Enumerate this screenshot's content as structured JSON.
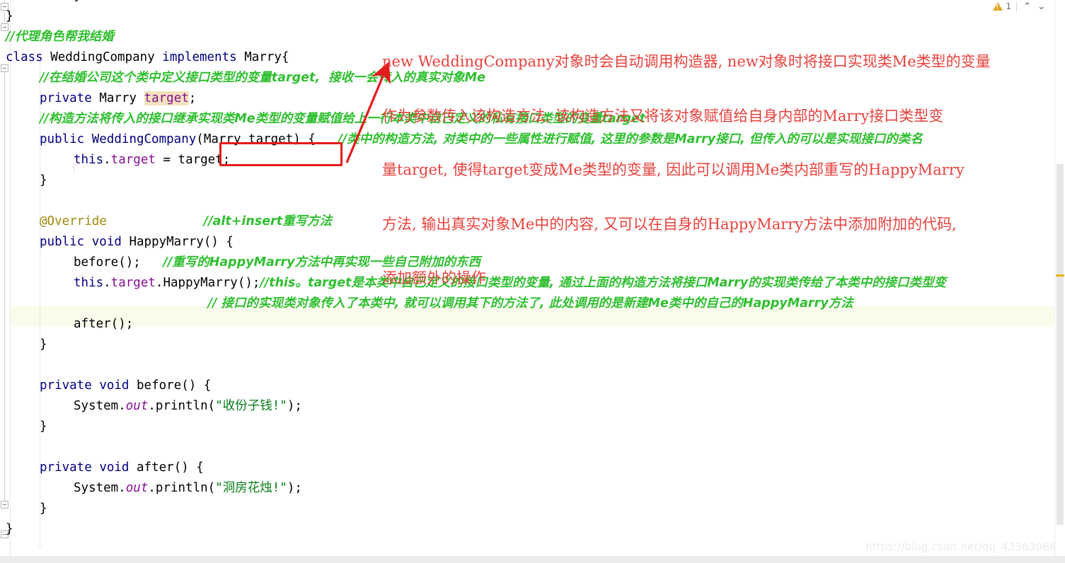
{
  "editor": {
    "language": "java",
    "font_px": 17.5,
    "line_height_px": 29,
    "theme": "IntelliJ Light"
  },
  "colors": {
    "keyword": "#000080",
    "comment_green": "#2fbf2f",
    "string": "#067d17",
    "field_purple": "#871094",
    "annotation_gold": "#9e880d",
    "red_annotation": "#e8413c",
    "red_box": "#e21b1b",
    "highlight_band": "#fbfbec",
    "token_highlight": "#f3e2bd",
    "warning_marker": "#e3b400"
  },
  "code_lines": [
    {
      "indent": 2,
      "tokens": [
        {
          "t": "}",
          "c": "plain"
        }
      ]
    },
    {
      "indent": 0,
      "tokens": [
        {
          "t": "}",
          "c": "plain"
        }
      ]
    },
    {
      "indent": 0,
      "tokens": [
        {
          "t": "//代理角色帮我结婚",
          "c": "cmt-cn"
        }
      ]
    },
    {
      "indent": 0,
      "tokens": [
        {
          "t": "class",
          "c": "kw"
        },
        {
          "t": " ",
          "c": "plain"
        },
        {
          "t": "WeddingCompany",
          "c": "ident"
        },
        {
          "t": " ",
          "c": "plain"
        },
        {
          "t": "implements",
          "c": "kw"
        },
        {
          "t": " ",
          "c": "plain"
        },
        {
          "t": "Marry{",
          "c": "ident"
        }
      ]
    },
    {
      "indent": 1,
      "tokens": [
        {
          "t": "//在结婚公司这个类中定义接口类型的变量target,  接收一会传入的真实对象Me",
          "c": "cmt-cn"
        }
      ]
    },
    {
      "indent": 1,
      "tokens": [
        {
          "t": "private",
          "c": "kw"
        },
        {
          "t": " ",
          "c": "plain"
        },
        {
          "t": "Marry",
          "c": "ident"
        },
        {
          "t": " ",
          "c": "plain"
        },
        {
          "t": "target",
          "c": "field-hl"
        },
        {
          "t": ";",
          "c": "plain"
        }
      ]
    },
    {
      "indent": 1,
      "tokens": [
        {
          "t": "//构造方法将传入的接口继承实现类Me类型的变量赋值给上一行本类中自己定义的私有接口类型的变量target",
          "c": "cmt-cn"
        }
      ]
    },
    {
      "indent": 1,
      "tokens": [
        {
          "t": "public",
          "c": "kw"
        },
        {
          "t": " ",
          "c": "plain"
        },
        {
          "t": "WeddingCompany",
          "c": "kw"
        },
        {
          "t": "(Marry target) {",
          "c": "plain"
        },
        {
          "t": "   ",
          "c": "plain"
        },
        {
          "t": "//类中的构造方法, 对类中的一些属性进行赋值, 这里的参数是Marry接口, 但传入的可以是实现接口的类名",
          "c": "cmt-cn"
        }
      ]
    },
    {
      "indent": 2,
      "tokens": [
        {
          "t": "this",
          "c": "kw"
        },
        {
          "t": ".",
          "c": "plain"
        },
        {
          "t": "target",
          "c": "field"
        },
        {
          "t": " = target;",
          "c": "plain"
        }
      ]
    },
    {
      "indent": 1,
      "tokens": [
        {
          "t": "}",
          "c": "plain"
        }
      ]
    },
    {
      "indent": 0,
      "tokens": []
    },
    {
      "indent": 1,
      "tokens": [
        {
          "t": "@Override",
          "c": "anno"
        },
        {
          "t": "             ",
          "c": "plain"
        },
        {
          "t": "//alt+insert重写方法",
          "c": "cmt-cn"
        }
      ]
    },
    {
      "indent": 1,
      "tokens": [
        {
          "t": "public",
          "c": "kw"
        },
        {
          "t": " ",
          "c": "plain"
        },
        {
          "t": "void",
          "c": "kw"
        },
        {
          "t": " ",
          "c": "plain"
        },
        {
          "t": "HappyMarry() {",
          "c": "plain"
        }
      ]
    },
    {
      "indent": 2,
      "tokens": [
        {
          "t": "before();",
          "c": "plain"
        },
        {
          "t": "   ",
          "c": "plain"
        },
        {
          "t": "//重写的HappyMarry方法中再实现一些自己附加的东西",
          "c": "cmt-cn"
        }
      ]
    },
    {
      "indent": 2,
      "tokens": [
        {
          "t": "this",
          "c": "kw"
        },
        {
          "t": ".",
          "c": "plain"
        },
        {
          "t": "target",
          "c": "field"
        },
        {
          "t": ".HappyMarry();",
          "c": "plain"
        },
        {
          "t": "//this。target是本类中自己定义的接口类型的变量, 通过上面的构造方法将接口Marry的实现类传给了本类中的接口类型变",
          "c": "cmt-cn"
        }
      ]
    },
    {
      "indent": 2,
      "tokens": [
        {
          "t": "                  ",
          "c": "plain"
        },
        {
          "t": "// 接口的实现类对象传入了本类中, 就可以调用其下的方法了, 此处调用的是新建Me类中的自己的HappyMarry方法",
          "c": "cmt-cn"
        }
      ]
    },
    {
      "indent": 2,
      "tokens": [
        {
          "t": "after();",
          "c": "plain"
        }
      ]
    },
    {
      "indent": 1,
      "tokens": [
        {
          "t": "}",
          "c": "plain"
        }
      ]
    },
    {
      "indent": 0,
      "tokens": []
    },
    {
      "indent": 1,
      "tokens": [
        {
          "t": "private",
          "c": "kw"
        },
        {
          "t": " ",
          "c": "plain"
        },
        {
          "t": "void",
          "c": "kw"
        },
        {
          "t": " ",
          "c": "plain"
        },
        {
          "t": "before() {",
          "c": "plain"
        }
      ]
    },
    {
      "indent": 2,
      "tokens": [
        {
          "t": "System",
          "c": "plain"
        },
        {
          "t": ".",
          "c": "plain"
        },
        {
          "t": "out",
          "c": "static"
        },
        {
          "t": ".println(",
          "c": "plain"
        },
        {
          "t": "\"收份子钱!\"",
          "c": "str"
        },
        {
          "t": ");",
          "c": "plain"
        }
      ]
    },
    {
      "indent": 1,
      "tokens": [
        {
          "t": "}",
          "c": "plain"
        }
      ]
    },
    {
      "indent": 0,
      "tokens": []
    },
    {
      "indent": 1,
      "tokens": [
        {
          "t": "private",
          "c": "kw"
        },
        {
          "t": " ",
          "c": "plain"
        },
        {
          "t": "void",
          "c": "kw"
        },
        {
          "t": " ",
          "c": "plain"
        },
        {
          "t": "after() {",
          "c": "plain"
        }
      ]
    },
    {
      "indent": 2,
      "tokens": [
        {
          "t": "System",
          "c": "plain"
        },
        {
          "t": ".",
          "c": "plain"
        },
        {
          "t": "out",
          "c": "static"
        },
        {
          "t": ".println(",
          "c": "plain"
        },
        {
          "t": "\"洞房花烛!\"",
          "c": "str"
        },
        {
          "t": ");",
          "c": "plain"
        }
      ]
    },
    {
      "indent": 1,
      "tokens": [
        {
          "t": "}",
          "c": "plain"
        }
      ]
    },
    {
      "indent": 0,
      "tokens": [
        {
          "t": "}",
          "c": "plain"
        }
      ]
    }
  ],
  "red_annotation": {
    "lines": [
      "new WeddingCompany对象时会自动调用构造器, new对象时将接口实现类Me类型的变量",
      "作为参数传入该构造方法, 该构造方法又将该对象赋值给自身内部的Marry接口类型变",
      "量target, 使得target变成Me类型的变量, 因此可以调用Me类内部重写的HappyMarry",
      "方法, 输出真实对象Me中的内容, 又可以在自身的HappyMarry方法中添加附加的代码,",
      "添加额外的操作"
    ],
    "arrow_from": "constructor-parameter-box",
    "arrow_to": "annotation-text"
  },
  "red_box": {
    "encloses": "(Marry target)"
  },
  "inspection_widget": {
    "warning_count": "1",
    "prev_label": "⌃",
    "next_label": "⌄"
  },
  "watermark": {
    "text": "https://blog.csdn.net/qq_43363066"
  }
}
